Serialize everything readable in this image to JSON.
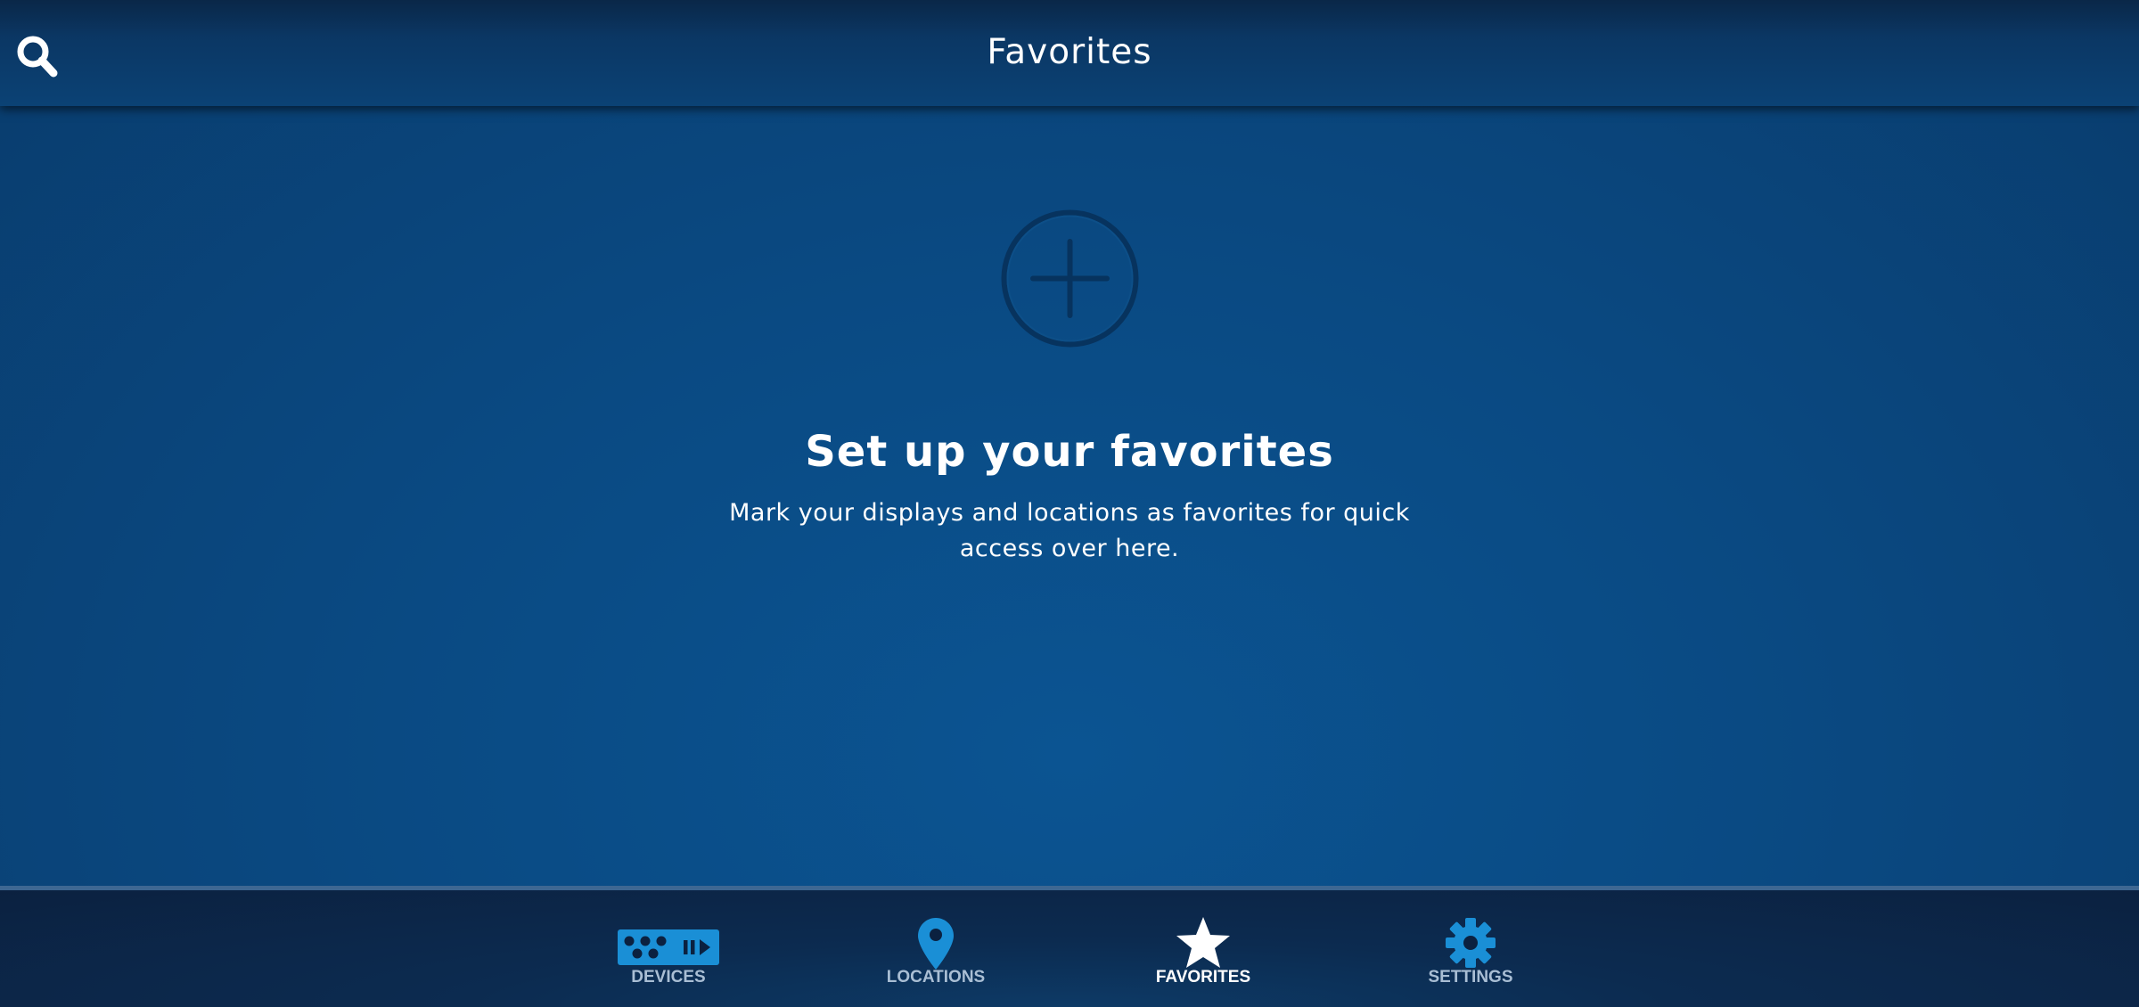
{
  "header": {
    "title": "Favorites",
    "search_icon": "search-icon"
  },
  "empty_state": {
    "icon": "add-circle-icon",
    "title": "Set up your favorites",
    "description": "Mark your displays and locations as favorites for quick access over here."
  },
  "tabbar": {
    "tabs": [
      {
        "label": "DEVICES",
        "icon": "devices-icon",
        "active": false
      },
      {
        "label": "LOCATIONS",
        "icon": "location-pin-icon",
        "active": false
      },
      {
        "label": "FAVORITES",
        "icon": "star-icon",
        "active": true
      },
      {
        "label": "SETTINGS",
        "icon": "gear-icon",
        "active": false
      }
    ]
  },
  "colors": {
    "accent": "#1a8fd6",
    "header_bg": "#0b3764",
    "content_bg": "#0a4a83",
    "tabbar_bg": "#0b2140",
    "inactive_label": "#a9bed4",
    "active_label": "#ffffff"
  }
}
